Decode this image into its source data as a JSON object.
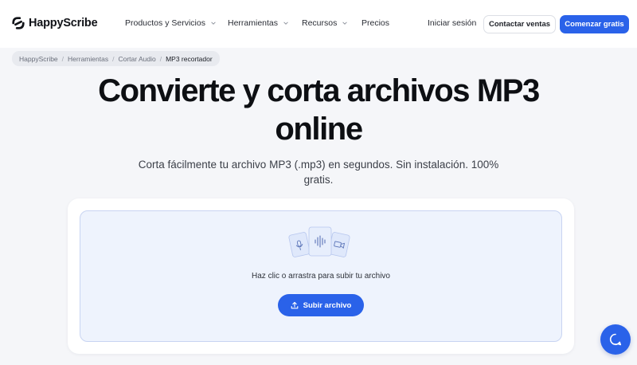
{
  "brand": {
    "name": "HappyScribe",
    "accent": "#2a62e9"
  },
  "nav": {
    "items": [
      {
        "label": "Productos y Servicios",
        "has_dropdown": true
      },
      {
        "label": "Herramientas",
        "has_dropdown": true
      },
      {
        "label": "Recursos",
        "has_dropdown": true
      },
      {
        "label": "Precios",
        "has_dropdown": false
      }
    ],
    "login": "Iniciar sesión",
    "contact": "Contactar ventas",
    "cta": "Comenzar gratis"
  },
  "breadcrumb": {
    "items": [
      "HappyScribe",
      "Herramientas",
      "Cortar Audio"
    ],
    "current": "MP3 recortador"
  },
  "hero": {
    "title_line1": "Convierte y corta archivos MP3",
    "title_line2": "online",
    "subtitle": "Corta fácilmente tu archivo MP3 (.mp3) en segundos. Sin instalación. 100% gratis."
  },
  "upload": {
    "prompt": "Haz clic o arrastra para subir tu archivo",
    "button": "Subir archivo",
    "icons": [
      "microphone-file-icon",
      "audio-waveform-file-icon",
      "video-file-icon"
    ]
  },
  "chat": {
    "icon": "chat-support-icon"
  }
}
